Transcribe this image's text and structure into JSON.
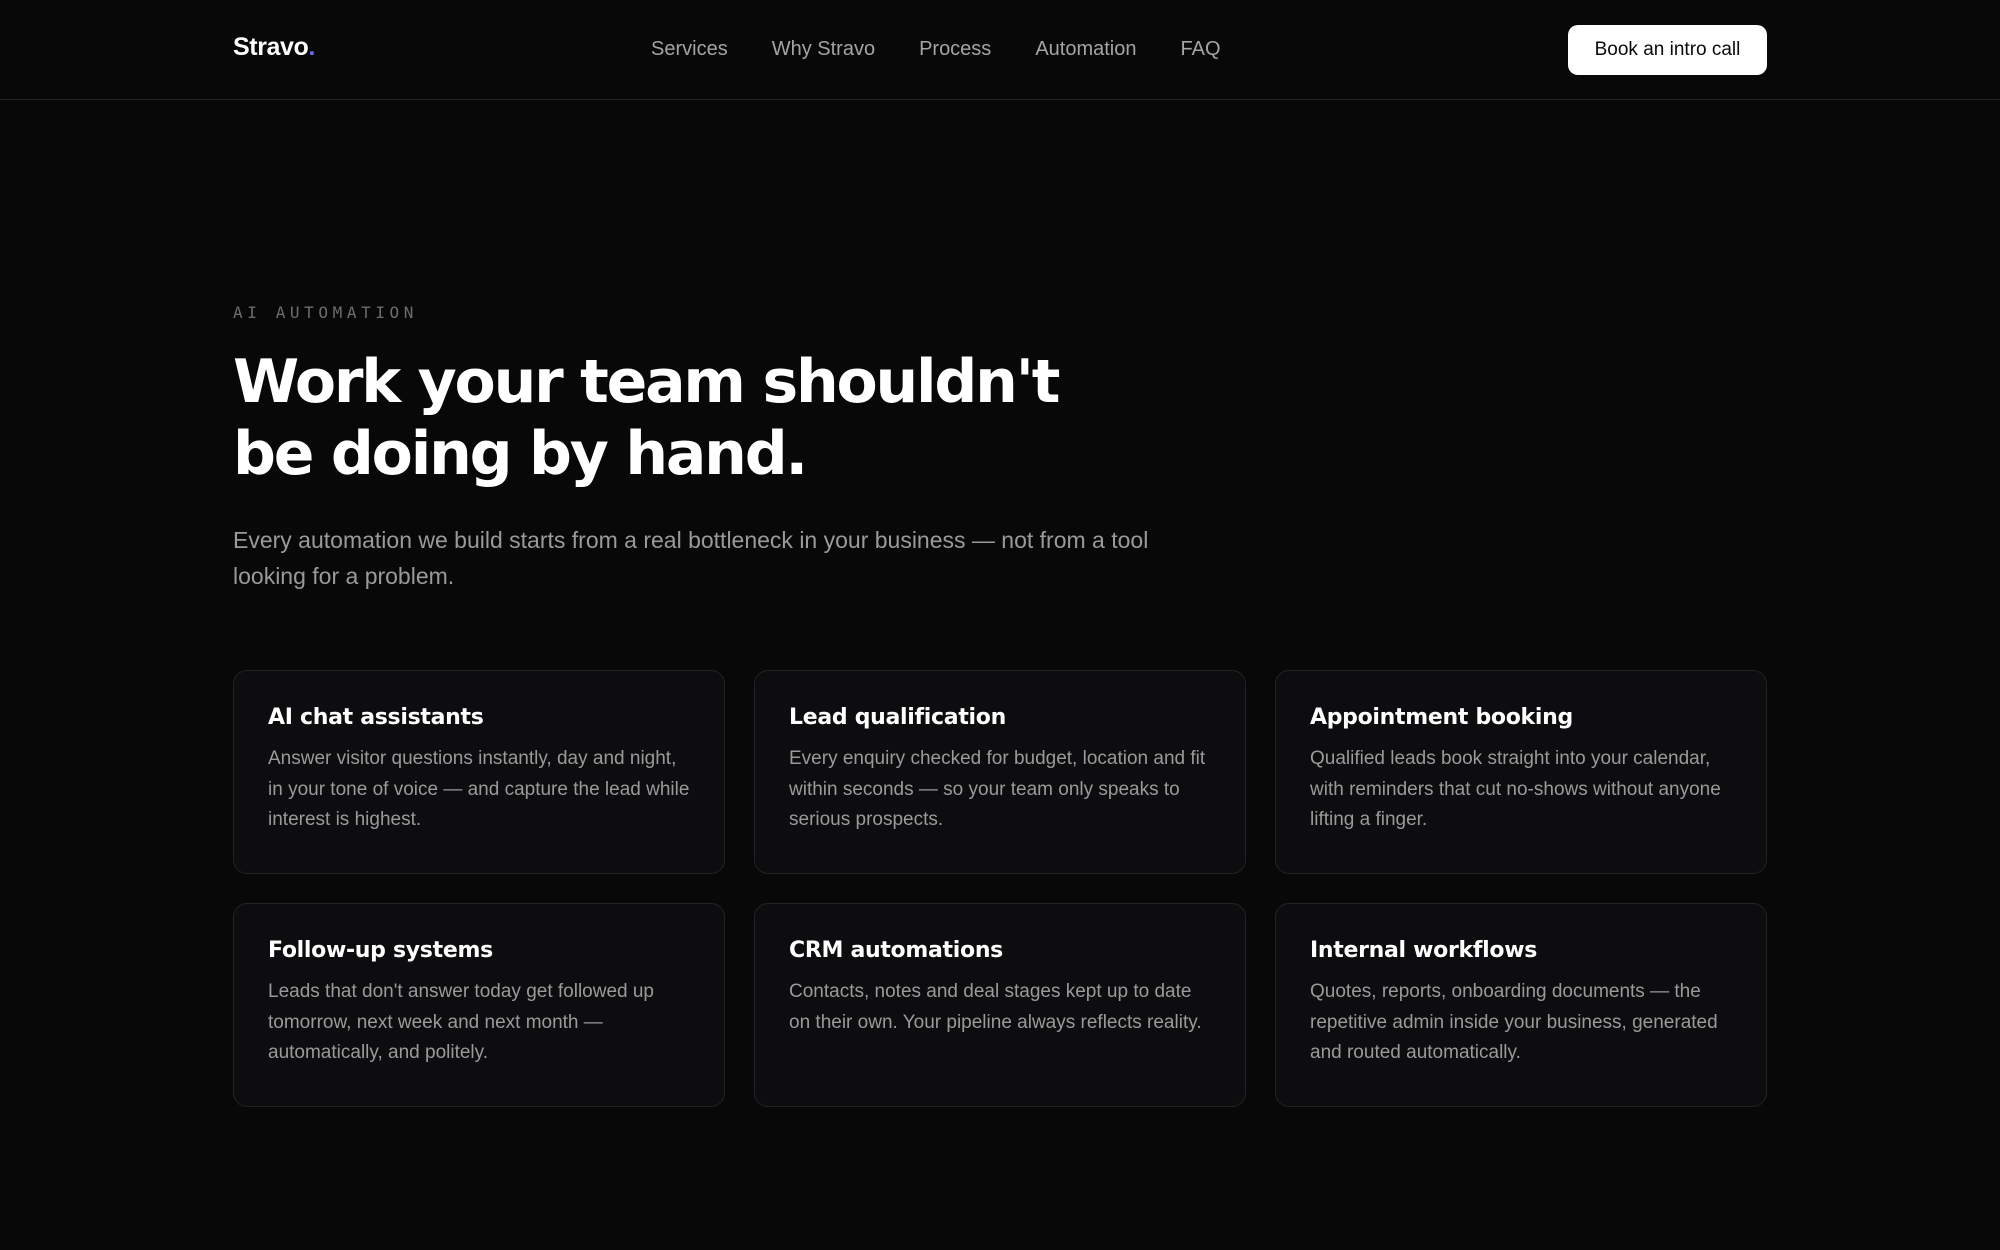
{
  "brand": {
    "name": "Stravo",
    "dot": ".",
    "accent_color": "#6b6bff"
  },
  "nav": {
    "items": [
      {
        "label": "Services"
      },
      {
        "label": "Why Stravo"
      },
      {
        "label": "Process"
      },
      {
        "label": "Automation"
      },
      {
        "label": "FAQ"
      }
    ],
    "cta_label": "Book an intro call"
  },
  "hero": {
    "eyebrow": "AI AUTOMATION",
    "headline": "Work your team shouldn't be doing by hand.",
    "subtitle": "Every automation we build starts from a real bottleneck in your business — not from a tool looking for a problem."
  },
  "cards": [
    {
      "title": "AI chat assistants",
      "description": "Answer visitor questions instantly, day and night, in your tone of voice — and capture the lead while interest is highest."
    },
    {
      "title": "Lead qualification",
      "description": "Every enquiry checked for budget, location and fit within seconds — so your team only speaks to serious prospects."
    },
    {
      "title": "Appointment booking",
      "description": "Qualified leads book straight into your calendar, with reminders that cut no-shows without anyone lifting a finger."
    },
    {
      "title": "Follow-up systems",
      "description": "Leads that don't answer today get followed up tomorrow, next week and next month — automatically, and politely."
    },
    {
      "title": "CRM automations",
      "description": "Contacts, notes and deal stages kept up to date on their own. Your pipeline always reflects reality."
    },
    {
      "title": "Internal workflows",
      "description": "Quotes, reports, onboarding documents — the repetitive admin inside your business, generated and routed automatically."
    }
  ],
  "colors": {
    "background": "#080808",
    "card_background": "#0d0d0f",
    "muted_text": "#9a9a9a",
    "cta_background": "#ffffff"
  }
}
